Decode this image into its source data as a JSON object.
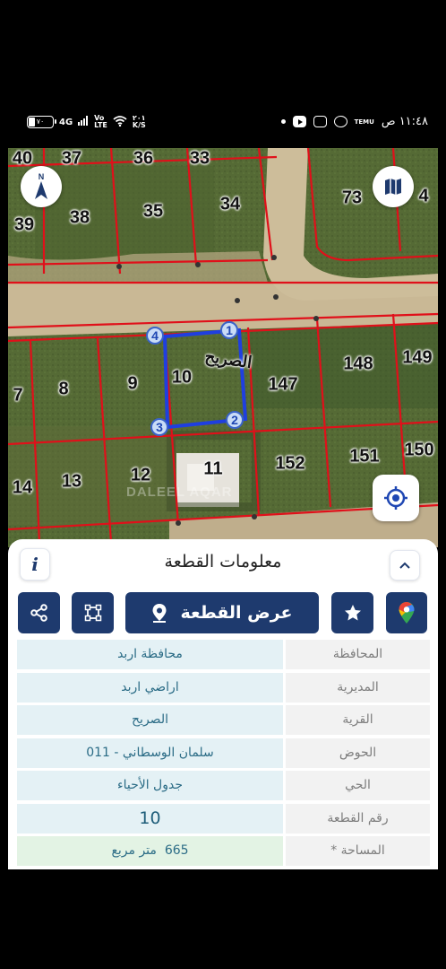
{
  "status_bar": {
    "battery": "٧٠",
    "network": "4G",
    "carrier_top": "Vo",
    "carrier_bottom": "LTE",
    "speed_top": "٢٠١",
    "speed_bottom": "K/S",
    "time": "١١:٤٨ ص",
    "teams_label": "TEMU"
  },
  "map": {
    "compass_letter": "N",
    "village_label": "الصريح",
    "watermark": "DALEEL AQAR",
    "selected_parcel_color": "#1f3fe0",
    "boundary_color": "#e0101a",
    "parcels": [
      "40",
      "37",
      "36",
      "33",
      "34",
      "35",
      "38",
      "39",
      "73",
      "4",
      "148",
      "149",
      "147",
      "10",
      "9",
      "8",
      "7",
      "152",
      "151",
      "150",
      "11",
      "12",
      "13",
      "14"
    ],
    "vertices": [
      "1",
      "2",
      "3",
      "4"
    ]
  },
  "panel": {
    "title": "معلومات القطعة",
    "info_label": "i",
    "show_parcel_label": "عرض القطعة",
    "fields": [
      {
        "label": "المحافظة",
        "value": "محافظة اربد"
      },
      {
        "label": "المديرية",
        "value": "اراضي اربد"
      },
      {
        "label": "القرية",
        "value": "الصريح"
      },
      {
        "label": "الحوض",
        "value": "سلمان الوسطاني - 011"
      },
      {
        "label": "الحي",
        "value": "جدول الأحياء"
      },
      {
        "label": "رقم القطعة",
        "value": "10"
      },
      {
        "label": "المساحة *",
        "value": "665  متر مربع"
      }
    ]
  },
  "colors": {
    "primary": "#1e3a6e",
    "value_bg": "#e4f1f5",
    "area_bg": "#e3f3e4"
  }
}
